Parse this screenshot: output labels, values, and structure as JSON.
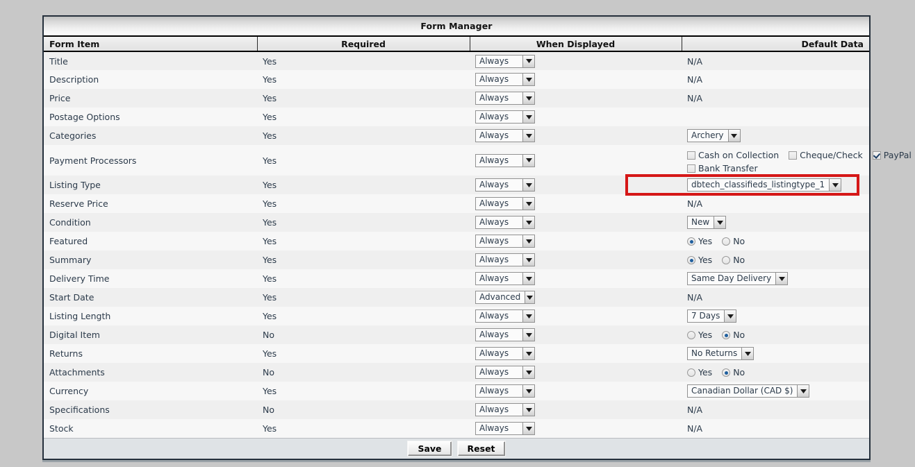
{
  "window": {
    "title": "Form Manager"
  },
  "table": {
    "columns": [
      "Form Item",
      "Required",
      "When Displayed",
      "Default Data"
    ],
    "rows": [
      {
        "item": "Title",
        "required": "Yes",
        "when": "Always",
        "data_type": "text",
        "data": "N/A"
      },
      {
        "item": "Description",
        "required": "Yes",
        "when": "Always",
        "data_type": "text",
        "data": "N/A"
      },
      {
        "item": "Price",
        "required": "Yes",
        "when": "Always",
        "data_type": "text",
        "data": "N/A"
      },
      {
        "item": "Postage Options",
        "required": "Yes",
        "when": "Always",
        "data_type": "empty",
        "data": ""
      },
      {
        "item": "Categories",
        "required": "Yes",
        "when": "Always",
        "data_type": "select",
        "data": "Archery"
      },
      {
        "item": "Payment Processors",
        "required": "Yes",
        "when": "Always",
        "data_type": "checkboxes",
        "checkboxes": [
          {
            "label": "Cash on Collection",
            "checked": false
          },
          {
            "label": "Cheque/Check",
            "checked": false
          },
          {
            "label": "PayPal",
            "checked": true
          },
          {
            "label": "Bank Transfer",
            "checked": false
          }
        ]
      },
      {
        "item": "Listing Type",
        "required": "Yes",
        "when": "Always",
        "data_type": "select",
        "data": "dbtech_classifieds_listingtype_1",
        "highlighted": true
      },
      {
        "item": "Reserve Price",
        "required": "Yes",
        "when": "Always",
        "data_type": "text",
        "data": "N/A"
      },
      {
        "item": "Condition",
        "required": "Yes",
        "when": "Always",
        "data_type": "select",
        "data": "New"
      },
      {
        "item": "Featured",
        "required": "Yes",
        "when": "Always",
        "data_type": "radio",
        "selected": "Yes",
        "options": [
          "Yes",
          "No"
        ]
      },
      {
        "item": "Summary",
        "required": "Yes",
        "when": "Always",
        "data_type": "radio",
        "selected": "Yes",
        "options": [
          "Yes",
          "No"
        ]
      },
      {
        "item": "Delivery Time",
        "required": "Yes",
        "when": "Always",
        "data_type": "select",
        "data": "Same Day Delivery"
      },
      {
        "item": "Start Date",
        "required": "Yes",
        "when": "Advanced",
        "data_type": "text",
        "data": "N/A"
      },
      {
        "item": "Listing Length",
        "required": "Yes",
        "when": "Always",
        "data_type": "select",
        "data": "7 Days"
      },
      {
        "item": "Digital Item",
        "required": "No",
        "when": "Always",
        "data_type": "radio",
        "selected": "No",
        "options": [
          "Yes",
          "No"
        ]
      },
      {
        "item": "Returns",
        "required": "Yes",
        "when": "Always",
        "data_type": "select",
        "data": "No Returns"
      },
      {
        "item": "Attachments",
        "required": "No",
        "when": "Always",
        "data_type": "radio",
        "selected": "No",
        "options": [
          "Yes",
          "No"
        ]
      },
      {
        "item": "Currency",
        "required": "Yes",
        "when": "Always",
        "data_type": "select",
        "data": "Canadian Dollar (CAD $)"
      },
      {
        "item": "Specifications",
        "required": "No",
        "when": "Always",
        "data_type": "text",
        "data": "N/A"
      },
      {
        "item": "Stock",
        "required": "Yes",
        "when": "Always",
        "data_type": "text",
        "data": "N/A"
      }
    ]
  },
  "footer": {
    "save_label": "Save",
    "reset_label": "Reset"
  },
  "annotation": {
    "highlight_color": "#d51717"
  }
}
